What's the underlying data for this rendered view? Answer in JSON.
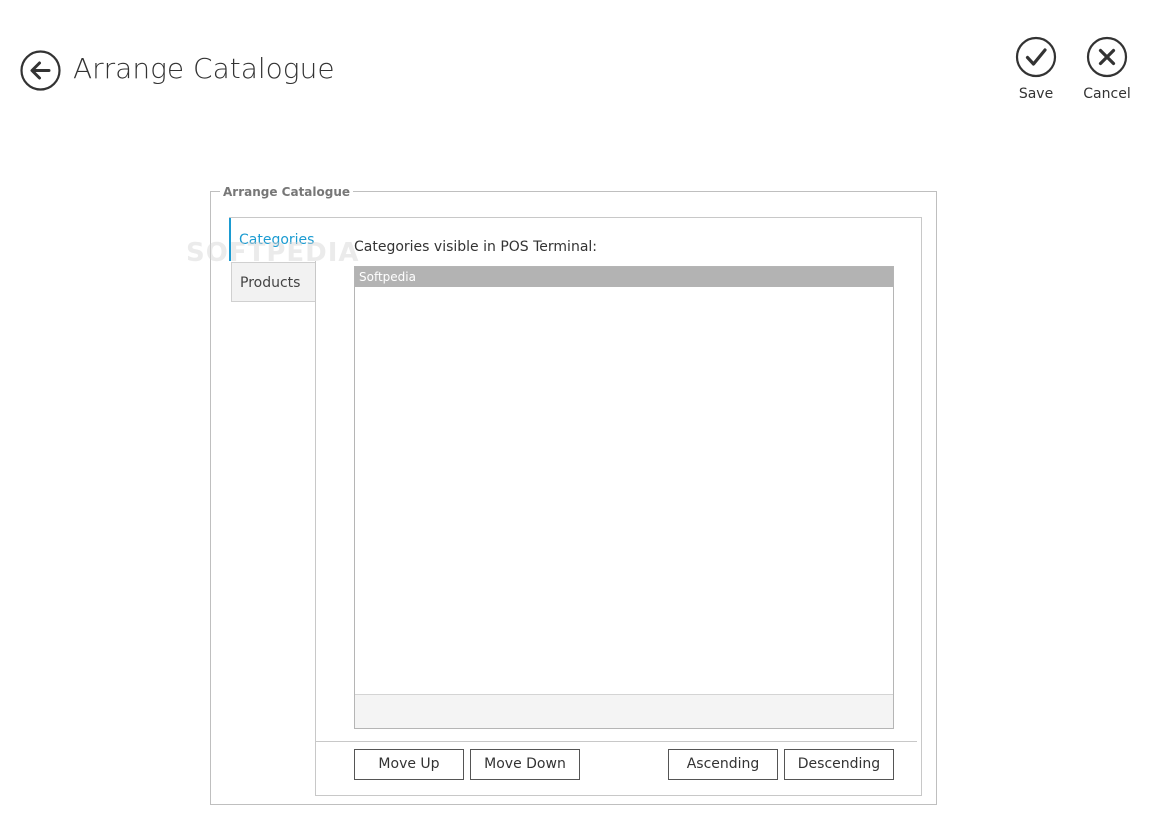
{
  "header": {
    "title": "Arrange Catalogue",
    "back_icon": "back-arrow-icon",
    "actions": {
      "save": {
        "label": "Save",
        "icon": "checkmark-icon"
      },
      "cancel": {
        "label": "Cancel",
        "icon": "close-icon"
      }
    }
  },
  "group": {
    "legend": "Arrange Catalogue"
  },
  "tabs": [
    {
      "label": "Categories",
      "active": true
    },
    {
      "label": "Products",
      "active": false
    }
  ],
  "panel": {
    "list_caption": "Categories visible in POS Terminal:",
    "items": [
      {
        "label": "Softpedia",
        "selected": true
      }
    ],
    "buttons": {
      "move_up": "Move Up",
      "move_down": "Move Down",
      "ascending": "Ascending",
      "descending": "Descending"
    }
  },
  "watermark": "SOFTPEDIA",
  "colors": {
    "accent": "#1b9bd1",
    "selected_row": "#b3b3b3",
    "text": "#333333"
  }
}
